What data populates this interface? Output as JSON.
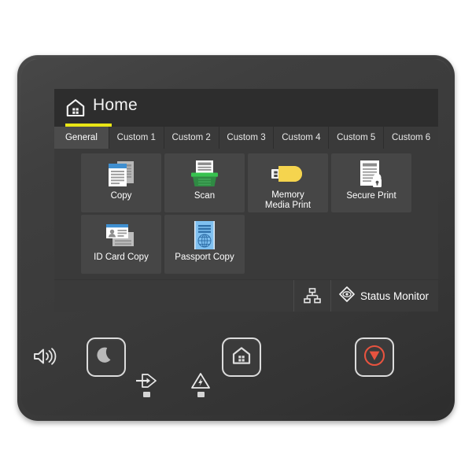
{
  "device": {
    "type": "printer-control-panel",
    "body_color": "#3c3c3c",
    "screen_bg": "#2d2d2d"
  },
  "screen": {
    "title": "Home",
    "title_icon": "home-icon",
    "accent_color": "#e9e515",
    "tabs": [
      {
        "label": "General",
        "active": true
      },
      {
        "label": "Custom 1",
        "active": false
      },
      {
        "label": "Custom 2",
        "active": false
      },
      {
        "label": "Custom 3",
        "active": false
      },
      {
        "label": "Custom 4",
        "active": false
      },
      {
        "label": "Custom 5",
        "active": false
      },
      {
        "label": "Custom 6",
        "active": false
      }
    ],
    "tiles": [
      {
        "label": "Copy",
        "icon": "copy-documents-icon",
        "color": "#3f8fd0"
      },
      {
        "label": "Scan",
        "icon": "scanner-icon",
        "color": "#2faa4e"
      },
      {
        "label": "Memory\nMedia Print",
        "icon": "usb-drive-icon",
        "color": "#f5d44e"
      },
      {
        "label": "Secure Print",
        "icon": "document-lock-icon",
        "color": "#e8e8e8"
      },
      {
        "label": "ID Card Copy",
        "icon": "id-cards-icon",
        "color": "#3f8fd0"
      },
      {
        "label": "Passport Copy",
        "icon": "passport-icon",
        "color": "#7fc0f0"
      }
    ],
    "status_bar": {
      "network_icon": "network-icon",
      "status_monitor_icon": "status-monitor-eye-icon",
      "status_monitor_label": "Status Monitor"
    }
  },
  "hardware": {
    "speaker_icon": "speaker-volume-icon",
    "buttons": [
      {
        "name": "sleep",
        "icon": "moon-icon",
        "color": "#b9b9b9"
      },
      {
        "name": "home",
        "icon": "house-icon",
        "color": "#dcdcdc"
      },
      {
        "name": "stop",
        "icon": "stop-icon",
        "color": "#e8533f"
      }
    ],
    "indicators": [
      {
        "name": "data",
        "icon": "data-arrow-icon",
        "led_color": "#d5d5d5"
      },
      {
        "name": "error",
        "icon": "error-triangle-icon",
        "led_color": "#d5d5d5"
      }
    ]
  }
}
